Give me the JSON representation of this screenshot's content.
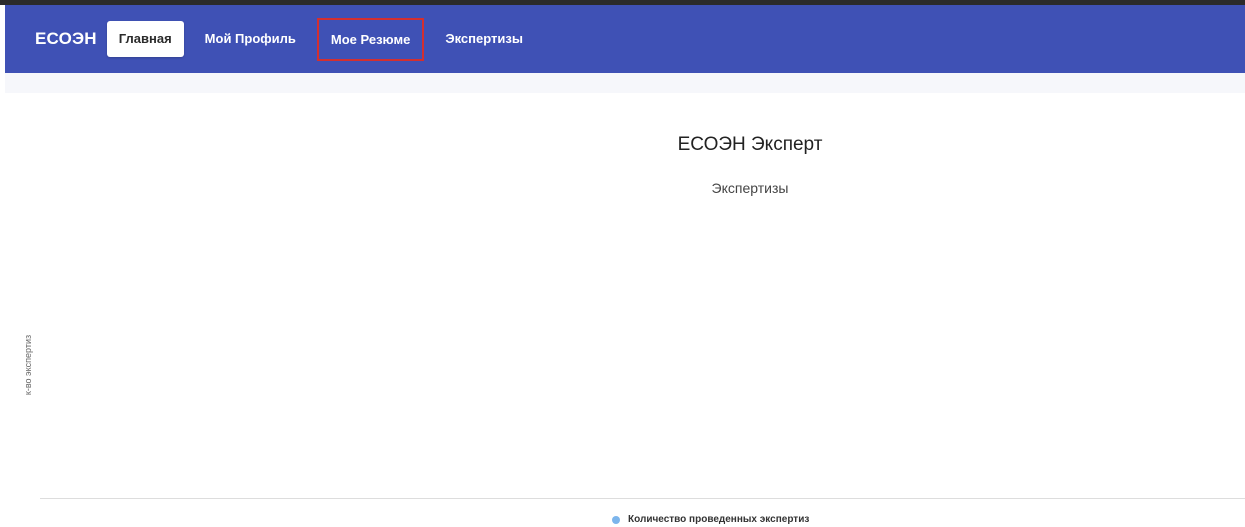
{
  "navbar": {
    "brand": "ЕСОЭН",
    "items": [
      {
        "label": "Главная"
      },
      {
        "label": "Мой Профиль"
      },
      {
        "label": "Мое Резюме"
      },
      {
        "label": "Экспертизы"
      }
    ]
  },
  "colors": {
    "navbar_bg": "#3f51b5",
    "highlight_border": "#d32f2f",
    "series_color": "#7cb5ec"
  },
  "chart_data": {
    "type": "bar",
    "title": "ЕСОЭН Эксперт",
    "subtitle": "Экспертизы",
    "ylabel": "к-во экспертиз",
    "categories": [],
    "series": [
      {
        "name": "Количество проведенных экспертиз",
        "values": []
      }
    ],
    "legend": "bottom-center"
  }
}
